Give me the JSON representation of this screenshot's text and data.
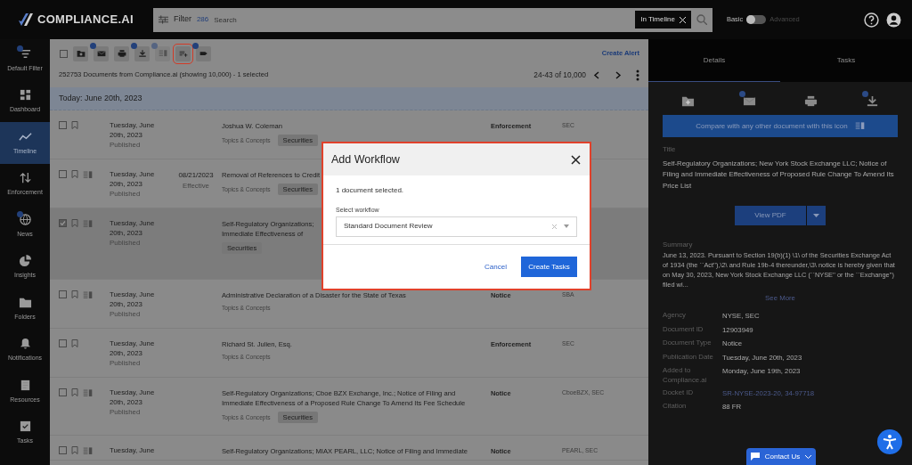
{
  "header": {
    "logo": "COMPLIANCE.AI",
    "filter_label": "Filter",
    "filter_count": "286",
    "search_placeholder": "Search",
    "scope_chip": "In Timeline",
    "mode_left": "Basic",
    "mode_right": "Advanced",
    "advanced_on": false
  },
  "sidebar": {
    "items": [
      {
        "label": "Default Filter",
        "kind": "filter",
        "badge": true,
        "selected": false
      },
      {
        "label": "Dashboard",
        "kind": "dashboard",
        "badge": false,
        "selected": false
      },
      {
        "label": "Timeline",
        "kind": "timeline",
        "badge": false,
        "selected": true
      },
      {
        "label": "Enforcement",
        "kind": "enforcement",
        "badge": false,
        "selected": false
      },
      {
        "label": "News",
        "kind": "news",
        "badge": true,
        "selected": false
      },
      {
        "label": "Insights",
        "kind": "insights",
        "badge": false,
        "selected": false
      },
      {
        "label": "Folders",
        "kind": "folders",
        "badge": false,
        "selected": false
      },
      {
        "label": "Notifications",
        "kind": "notifications",
        "badge": false,
        "selected": false
      },
      {
        "label": "Resources",
        "kind": "resources",
        "badge": false,
        "selected": false
      },
      {
        "label": "Tasks",
        "kind": "tasks",
        "badge": false,
        "selected": false
      }
    ]
  },
  "toolbar": {
    "select_all_checked": false,
    "buttons": [
      {
        "kind": "folder",
        "badge": false,
        "disabled": false,
        "highlighted": false
      },
      {
        "kind": "mail",
        "badge": true,
        "disabled": false,
        "highlighted": false
      },
      {
        "kind": "print",
        "badge": false,
        "disabled": false,
        "highlighted": false
      },
      {
        "kind": "download",
        "badge": true,
        "disabled": false,
        "highlighted": false
      },
      {
        "kind": "compare",
        "badge": true,
        "disabled": true,
        "highlighted": false
      },
      {
        "kind": "workflow",
        "badge": false,
        "disabled": false,
        "highlighted": true
      },
      {
        "kind": "tag",
        "badge": true,
        "disabled": false,
        "highlighted": false
      }
    ],
    "create_alert": "Create Alert",
    "summary": "252753 Documents from Compliance.ai (showing 10,000) - 1 selected",
    "pagination": "24-43 of 10,000"
  },
  "day_header": "Today: June 20th, 2023",
  "rows": [
    {
      "checked": false,
      "selected": false,
      "compare": false,
      "date": "Tuesday, June 20th, 2023",
      "status": "Published",
      "title_lines": [
        "Joshua W. Coleman"
      ],
      "topics_label": "Topics & Concepts",
      "tag": "Securities",
      "type": "Enforcement",
      "agency": "SEC"
    },
    {
      "checked": false,
      "selected": false,
      "compare": true,
      "date": "Tuesday, June 20th, 2023",
      "status": "Published",
      "effective": "08/21/2023",
      "effective_label": "Effective",
      "title_lines": [
        "Removal of References to Credit"
      ],
      "topics_label": "Topics & Concepts",
      "tag": "Securities"
    },
    {
      "checked": true,
      "selected": true,
      "compare": true,
      "date": "Tuesday, June 20th, 2023",
      "status": "Published",
      "title_lines": [
        "Self-Regulatory Organizations;",
        "Immediate Effectiveness of"
      ],
      "tag": "Securities"
    },
    {
      "checked": false,
      "selected": false,
      "compare": true,
      "date": "Tuesday, June 20th, 2023",
      "status": "Published",
      "title_lines": [
        "Administrative Declaration of a Disaster for the State of Texas"
      ],
      "topics_label": "Topics & Concepts",
      "type": "Notice",
      "agency": "SBA"
    },
    {
      "checked": false,
      "selected": false,
      "compare": false,
      "date": "Tuesday, June 20th, 2023",
      "status": "Published",
      "title_lines": [
        "Richard St. Julien, Esq."
      ],
      "topics_label": "Topics & Concepts",
      "type": "Enforcement",
      "agency": "SEC"
    },
    {
      "checked": false,
      "selected": false,
      "compare": true,
      "date": "Tuesday, June 20th, 2023",
      "status": "Published",
      "title_lines": [
        "Self-Regulatory Organizations; Cboe BZX Exchange, Inc.; Notice of Filing and",
        "Immediate Effectiveness of a Proposed Rule Change To Amend Its Fee Schedule"
      ],
      "topics_label": "Topics & Concepts",
      "tag": "Securities",
      "type": "Notice",
      "agency": "CboeBZX, SEC"
    },
    {
      "checked": false,
      "selected": false,
      "compare": true,
      "date": "Tuesday, June",
      "title_lines": [
        "Self-Regulatory Organizations; MIAX PEARL, LLC; Notice of Filing and Immediate"
      ],
      "type": "Notice",
      "agency": "PEARL, SEC"
    }
  ],
  "modal": {
    "title": "Add Workflow",
    "message": "1 document selected.",
    "field_label": "Select workflow",
    "field_value": "Standard Document Review",
    "cancel": "Cancel",
    "submit": "Create Tasks"
  },
  "details": {
    "tabs": [
      {
        "label": "Details",
        "selected": true
      },
      {
        "label": "Tasks",
        "selected": false
      }
    ],
    "actions": [
      {
        "kind": "folder",
        "badge": false
      },
      {
        "kind": "mail",
        "badge": true
      },
      {
        "kind": "print",
        "badge": false
      },
      {
        "kind": "download",
        "badge": true
      }
    ],
    "compare_banner": "Compare with any other document with this icon",
    "title_label": "Title",
    "title": "Self-Regulatory Organizations; New York Stock Exchange LLC; Notice of Filing and Immediate Effectiveness of Proposed Rule Change To Amend Its Price List",
    "view_pdf": "View PDF",
    "summary_label": "Summary",
    "summary": "June 13, 2023. Pursuant to Section 19(b)(1) \\1\\ of the Securities Exchange Act of 1934 (the ``Act''),\\2\\ and Rule 19b-4 thereunder,\\3\\ notice is hereby given that on May 30, 2023, New York Stock Exchange LLC (``NYSE'' or the ``Exchange'') filed wi...",
    "see_more": "See More",
    "fields": [
      {
        "label": "Agency",
        "value": "NYSE, SEC",
        "kind": "text"
      },
      {
        "label": "Document ID",
        "value": "12903949",
        "kind": "text"
      },
      {
        "label": "Document Type",
        "value": "Notice",
        "kind": "text"
      },
      {
        "label": "Publication Date",
        "value": "Tuesday, June 20th, 2023",
        "kind": "text"
      },
      {
        "label": "Added to Compliance.ai",
        "value": "Monday, June 19th, 2023",
        "kind": "text"
      },
      {
        "label": "Docket ID",
        "value": "SR-NYSE-2023-20, 34-97718",
        "kind": "link"
      },
      {
        "label": "Citation",
        "value": "88 FR",
        "kind": "text"
      }
    ]
  },
  "contact": "Contact Us"
}
